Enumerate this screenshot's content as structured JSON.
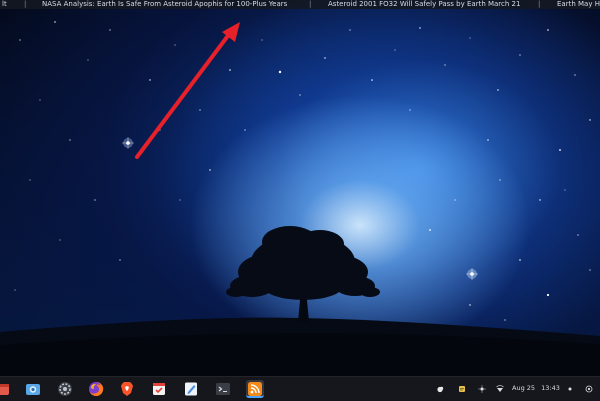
{
  "ticker": {
    "items": [
      "lt",
      "NASA Analysis: Earth Is Safe From Asteroid Apophis for 100-Plus Years",
      "Asteroid 2001 FO32 Will Safely Pass by Earth March 21",
      "Earth May H"
    ],
    "separator": "|"
  },
  "annotation": {
    "arrow_color": "#e8202a"
  },
  "taskbar": {
    "apps": [
      {
        "icon": "files-icon",
        "color": "#e25a4a"
      },
      {
        "icon": "screenshot-icon",
        "color": "#5aa7e8"
      },
      {
        "icon": "settings-icon",
        "color": "#9aa0a8"
      },
      {
        "icon": "firefox-icon",
        "color": "#ff7a1a"
      },
      {
        "icon": "brave-icon",
        "color": "#fb542b"
      },
      {
        "icon": "calendar-icon",
        "color": "#e8e8e8"
      },
      {
        "icon": "text-editor-icon",
        "color": "#4a8fe0"
      },
      {
        "icon": "terminal-icon",
        "color": "#3a3d44"
      },
      {
        "icon": "rss-reader-icon",
        "color": "#f28a1c"
      }
    ],
    "tray": [
      "weather-icon",
      "notes-icon",
      "brightness-icon",
      "network-icon"
    ],
    "clock": {
      "date": "Aug 25",
      "time": "13:43"
    },
    "tray_end": [
      "notification-dot-icon",
      "power-icon"
    ]
  }
}
